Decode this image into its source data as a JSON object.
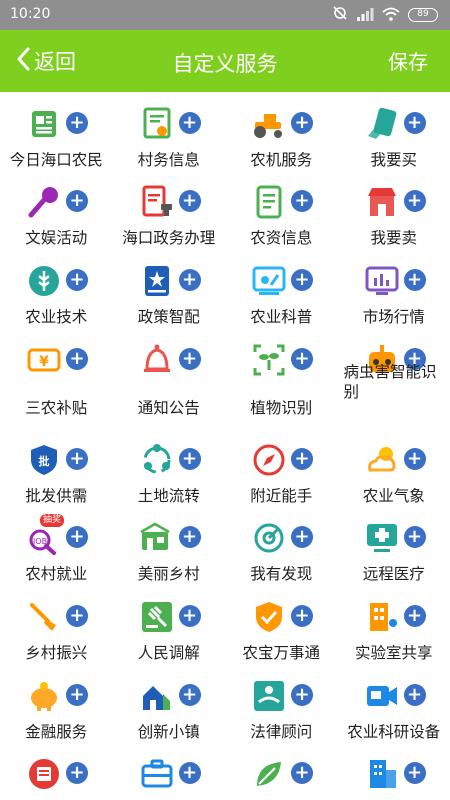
{
  "status_bar": {
    "time": "10:20",
    "battery": "89"
  },
  "header": {
    "back_label": "返回",
    "title": "自定义服务",
    "save_label": "保存"
  },
  "colors": {
    "header": "#7fcf1f",
    "add_button": "#3a6fc4",
    "status_bar": "#8f8f8f"
  },
  "services": [
    {
      "label": "今日海口农民",
      "icon": "newspaper-icon",
      "color": "#4caf50"
    },
    {
      "label": "村务信息",
      "icon": "certificate-icon",
      "color": "#4caf50"
    },
    {
      "label": "农机服务",
      "icon": "tractor-icon",
      "color": "#ff9800"
    },
    {
      "label": "我要买",
      "icon": "pay-card-icon",
      "color": "#26a69a"
    },
    {
      "label": "文娱活动",
      "icon": "microphone-icon",
      "color": "#9c27b0"
    },
    {
      "label": "海口政务办理",
      "icon": "document-stamp-icon",
      "color": "#e53935"
    },
    {
      "label": "农资信息",
      "icon": "document-icon",
      "color": "#4caf50"
    },
    {
      "label": "我要卖",
      "icon": "store-icon",
      "color": "#e53935"
    },
    {
      "label": "农业技术",
      "icon": "wheat-badge-icon",
      "color": "#26a69a"
    },
    {
      "label": "政策智配",
      "icon": "policy-book-icon",
      "color": "#1e5eb8"
    },
    {
      "label": "农业科普",
      "icon": "science-screen-icon",
      "color": "#29b6f6"
    },
    {
      "label": "市场行情",
      "icon": "market-chart-icon",
      "color": "#7e57c2"
    },
    {
      "label": "三农补贴",
      "icon": "yuan-ticket-icon",
      "color": "#ff9800"
    },
    {
      "label": "通知公告",
      "icon": "bell-icon",
      "color": "#ef5350"
    },
    {
      "label": "植物识别",
      "icon": "plant-scan-icon",
      "color": "#4caf50"
    },
    {
      "label": "病虫害智能识别",
      "icon": "robot-icon",
      "color": "#ff9800"
    },
    {
      "label": "批发供需",
      "icon": "wholesale-shield-icon",
      "color": "#1e5eb8"
    },
    {
      "label": "土地流转",
      "icon": "land-transfer-icon",
      "color": "#26a69a"
    },
    {
      "label": "附近能手",
      "icon": "compass-icon",
      "color": "#e53935"
    },
    {
      "label": "农业气象",
      "icon": "weather-icon",
      "color": "#ffa726"
    },
    {
      "label": "农村就业",
      "icon": "job-search-icon",
      "color": "#9c27b0",
      "badge": "抽奖"
    },
    {
      "label": "美丽乡村",
      "icon": "village-icon",
      "color": "#4caf50"
    },
    {
      "label": "我有发现",
      "icon": "discover-icon",
      "color": "#26a69a"
    },
    {
      "label": "远程医疗",
      "icon": "telemedicine-icon",
      "color": "#26a69a"
    },
    {
      "label": "乡村振兴",
      "icon": "shovel-icon",
      "color": "#ff9800"
    },
    {
      "label": "人民调解",
      "icon": "gavel-icon",
      "color": "#4caf50"
    },
    {
      "label": "农宝万事通",
      "icon": "check-shield-icon",
      "color": "#ff9800"
    },
    {
      "label": "实验室共享",
      "icon": "lab-building-icon",
      "color": "#ff9800"
    },
    {
      "label": "金融服务",
      "icon": "piggy-bank-icon",
      "color": "#ffa726"
    },
    {
      "label": "创新小镇",
      "icon": "town-icon",
      "color": "#1e5eb8"
    },
    {
      "label": "法律顾问",
      "icon": "legal-handshake-icon",
      "color": "#26a69a"
    },
    {
      "label": "农业科研设备",
      "icon": "research-camera-icon",
      "color": "#1e88e5"
    },
    {
      "label": "",
      "icon": "news-circle-icon",
      "color": "#e53935"
    },
    {
      "label": "",
      "icon": "briefcase-icon",
      "color": "#1e88e5"
    },
    {
      "label": "",
      "icon": "leaf-icon",
      "color": "#4caf50"
    },
    {
      "label": "",
      "icon": "office-building-icon",
      "color": "#1e88e5"
    }
  ]
}
